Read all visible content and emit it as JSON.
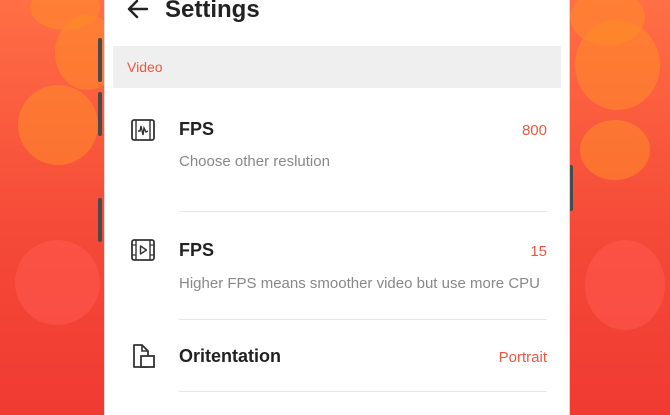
{
  "header": {
    "back_icon": "arrow-left-icon",
    "title": "Settings"
  },
  "section": {
    "label": "Video"
  },
  "rows": [
    {
      "icon": "video-waveform-icon",
      "title": "FPS",
      "value": "800",
      "description": "Choose other reslution"
    },
    {
      "icon": "video-play-icon",
      "title": "FPS",
      "value": "15",
      "description": "Higher FPS means smoother video but use more CPU"
    },
    {
      "icon": "orientation-icon",
      "title": "Oritentation",
      "value": "Portrait"
    }
  ],
  "colors": {
    "accent": "#f0563f",
    "background": "#f54a38"
  }
}
